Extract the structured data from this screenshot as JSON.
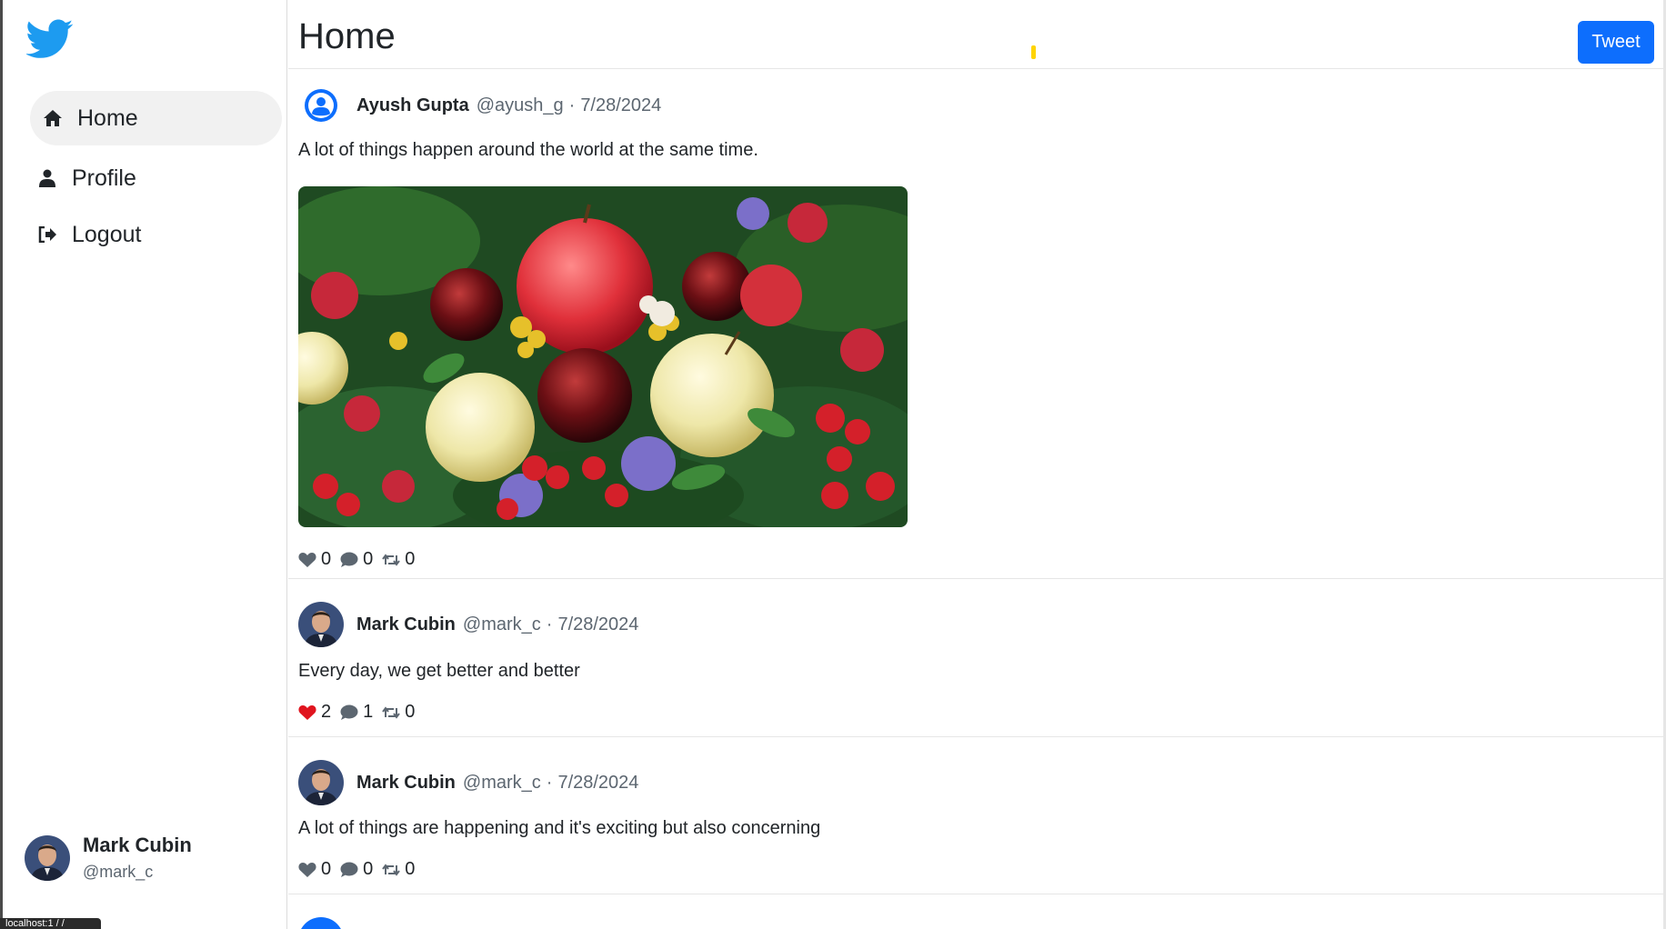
{
  "sidebar": {
    "logo_icon": "twitter-bird-icon",
    "nav": [
      {
        "label": "Home",
        "icon": "home-icon",
        "active": true
      },
      {
        "label": "Profile",
        "icon": "user-icon"
      },
      {
        "label": "Logout",
        "icon": "sign-out-icon"
      }
    ],
    "user": {
      "name": "Mark Cubin",
      "handle": "@mark_c"
    }
  },
  "status_bar": {
    "url": "localhost:1 / /"
  },
  "header": {
    "title": "Home",
    "tweet_button": "Tweet"
  },
  "colors": {
    "accent": "#0d6efd",
    "liked": "#e0141e",
    "twitter_blue": "#1d9bf0"
  },
  "posts": [
    {
      "author": "Ayush Gupta",
      "handle": "@ayush_g",
      "separator": "·",
      "date": "7/28/2024",
      "avatar": "default-user-avatar",
      "text": "A lot of things happen around the world at the same time.",
      "has_image": true,
      "image_subject": "fruit-and-flowers-photo",
      "likes": "0",
      "comments": "0",
      "retweets": "0",
      "liked": false
    },
    {
      "author": "Mark Cubin",
      "handle": "@mark_c",
      "separator": "·",
      "date": "7/28/2024",
      "avatar": "photo-avatar",
      "text": "Every day, we get better and better",
      "likes": "2",
      "comments": "1",
      "retweets": "0",
      "liked": true
    },
    {
      "author": "Mark Cubin",
      "handle": "@mark_c",
      "separator": "·",
      "date": "7/28/2024",
      "avatar": "photo-avatar",
      "text": "A lot of things are happening and it's exciting but also concerning",
      "likes": "0",
      "comments": "0",
      "retweets": "0",
      "liked": false
    }
  ]
}
